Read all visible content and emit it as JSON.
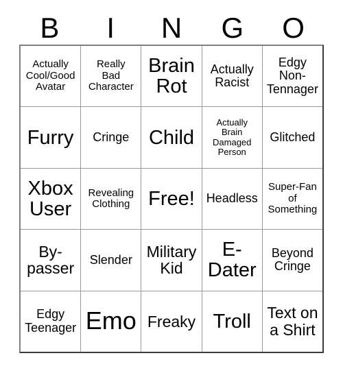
{
  "card": {
    "title_letters": [
      "B",
      "I",
      "N",
      "G",
      "O"
    ],
    "free_space_label": "Free!",
    "colors": {
      "text": "#000000",
      "background": "#ffffff",
      "grid_line": "#9a9a9a",
      "grid_border": "#3a3a3a"
    },
    "rows": [
      [
        {
          "text": "Actually\nCool/Good\nAvatar",
          "size": "sm"
        },
        {
          "text": "Really\nBad\nCharacter",
          "size": "sm"
        },
        {
          "text": "Brain\nRot",
          "size": "xl"
        },
        {
          "text": "Actually\nRacist",
          "size": "md"
        },
        {
          "text": "Edgy\nNon-\nTennager",
          "size": "md"
        }
      ],
      [
        {
          "text": "Furry",
          "size": "xl"
        },
        {
          "text": "Cringe",
          "size": "md"
        },
        {
          "text": "Child",
          "size": "xl"
        },
        {
          "text": "Actually\nBrain\nDamaged\nPerson",
          "size": "xs"
        },
        {
          "text": "Glitched",
          "size": "md"
        }
      ],
      [
        {
          "text": "Xbox\nUser",
          "size": "xl"
        },
        {
          "text": "Revealing\nClothing",
          "size": "sm"
        },
        {
          "text": "Free!",
          "size": "xl"
        },
        {
          "text": "Headless",
          "size": "md"
        },
        {
          "text": "Super-Fan\nof\nSomething",
          "size": "sm"
        }
      ],
      [
        {
          "text": "By-\npasser",
          "size": "lg"
        },
        {
          "text": "Slender",
          "size": "md"
        },
        {
          "text": "Military\nKid",
          "size": "lg"
        },
        {
          "text": "E-\nDater",
          "size": "xl"
        },
        {
          "text": "Beyond\nCringe",
          "size": "md"
        }
      ],
      [
        {
          "text": "Edgy\nTeenager",
          "size": "md"
        },
        {
          "text": "Emo",
          "size": "xxl"
        },
        {
          "text": "Freaky",
          "size": "lg"
        },
        {
          "text": "Troll",
          "size": "xl"
        },
        {
          "text": "Text on\na Shirt",
          "size": "lg"
        }
      ]
    ]
  }
}
